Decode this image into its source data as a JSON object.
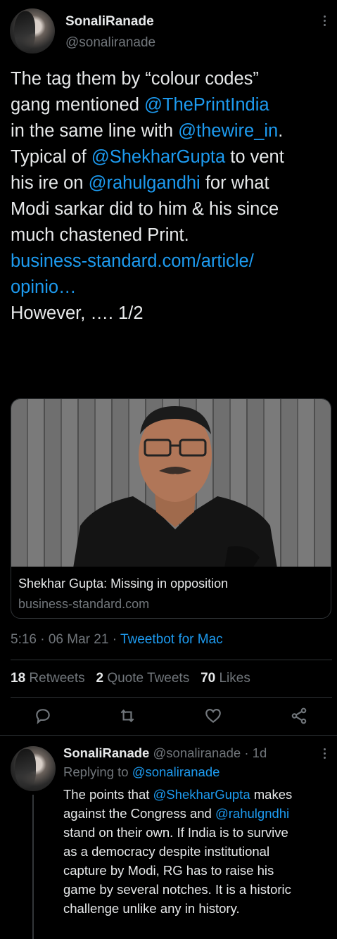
{
  "tweet": {
    "author_name": "SonaliRanade",
    "author_handle": "@sonaliranade",
    "lines": [
      [
        {
          "t": "The tag them by “colour codes”"
        }
      ],
      [
        {
          "t": "gang mentioned "
        },
        {
          "t": "@ThePrintIndia",
          "link": true
        }
      ],
      [
        {
          "t": "in the same line with  "
        },
        {
          "t": "@thewire_in",
          "link": true
        },
        {
          "t": "."
        }
      ],
      [
        {
          "t": "Typical of "
        },
        {
          "t": "@ShekharGupta",
          "link": true
        },
        {
          "t": " to vent"
        }
      ],
      [
        {
          "t": "his ire on "
        },
        {
          "t": "@rahulgandhi",
          "link": true
        },
        {
          "t": " for what"
        }
      ],
      [
        {
          "t": "Modi sarkar did to him & his since"
        }
      ],
      [
        {
          "t": "much chastened Print."
        }
      ],
      [
        {
          "t": " "
        }
      ],
      [
        {
          "t": "business-standard.com/article/",
          "link": true
        }
      ],
      [
        {
          "t": "opinio…",
          "link": true
        }
      ],
      [
        {
          "t": " "
        }
      ],
      [
        {
          "t": "However, …. 1/2"
        }
      ]
    ],
    "card": {
      "title": "Shekhar Gupta: Missing in opposition",
      "domain": "business-standard.com"
    },
    "time": "5:16 · 06 Mar 21 · ",
    "source": "Tweetbot for Mac",
    "stats": {
      "retweets_count": "18",
      "retweets_label": "Retweets",
      "quotes_count": "2",
      "quotes_label": "Quote Tweets",
      "likes_count": "70",
      "likes_label": "Likes"
    },
    "actions": [
      "reply-icon",
      "retweet-icon",
      "like-icon",
      "share-icon"
    ]
  },
  "reply": {
    "author_name": "SonaliRanade",
    "author_handle": "@sonaliranade",
    "age": " · 1d",
    "replying_prefix": "Replying to ",
    "replying_to": "@sonaliranade",
    "lines": [
      [
        {
          "t": "The points that "
        },
        {
          "t": "@ShekharGupta",
          "link": true
        },
        {
          "t": " makes"
        }
      ],
      [
        {
          "t": "against the Congress and "
        },
        {
          "t": "@rahulgndhi",
          "link": true
        }
      ],
      [
        {
          "t": "stand on their own.  If India is to survive"
        }
      ],
      [
        {
          "t": "as a democracy despite institutional"
        }
      ],
      [
        {
          "t": "capture by Modi, RG has to raise his"
        }
      ],
      [
        {
          "t": "game by several notches.  It is a historic"
        }
      ],
      [
        {
          "t": "challenge unlike any in history."
        }
      ]
    ]
  },
  "colors": {
    "background": "#000000",
    "text": "#e7e9ea",
    "muted": "#71767b",
    "link": "#1d9bf0",
    "border": "#2f3336"
  }
}
